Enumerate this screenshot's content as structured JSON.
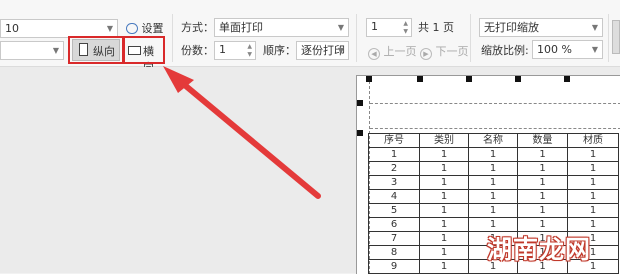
{
  "toolbar": {
    "font_size_value": "10",
    "setup_label": "设置",
    "portrait_label": "纵向",
    "landscape_label": "横向",
    "mode_label": "方式：",
    "mode_value": "单面打印",
    "copies_label": "份数：",
    "copies_value": "1",
    "order_label": "顺序：",
    "order_value": "逐份打印",
    "page_value": "1",
    "total_pages": "共 1 页",
    "prev_page": "上一页",
    "next_page": "下一页",
    "scale_mode_value": "无打印缩放",
    "zoom_label": "缩放比例:",
    "zoom_value": "100 %"
  },
  "sheet": {
    "headers": [
      "序号",
      "类别",
      "名称",
      "数量",
      "材质"
    ],
    "rows": [
      [
        "1",
        "1",
        "1",
        "1",
        "1"
      ],
      [
        "2",
        "1",
        "1",
        "1",
        "1"
      ],
      [
        "3",
        "1",
        "1",
        "1",
        "1"
      ],
      [
        "4",
        "1",
        "1",
        "1",
        "1"
      ],
      [
        "5",
        "1",
        "1",
        "1",
        "1"
      ],
      [
        "6",
        "1",
        "1",
        "1",
        "1"
      ],
      [
        "7",
        "1",
        "1",
        "1",
        "1"
      ],
      [
        "8",
        "1",
        "1",
        "1",
        "1"
      ],
      [
        "9",
        "1",
        "1",
        "1",
        "1"
      ]
    ]
  },
  "watermark": "湖南龙网",
  "colors": {
    "highlight": "#d9292a",
    "arrow": "#e43a3a"
  }
}
